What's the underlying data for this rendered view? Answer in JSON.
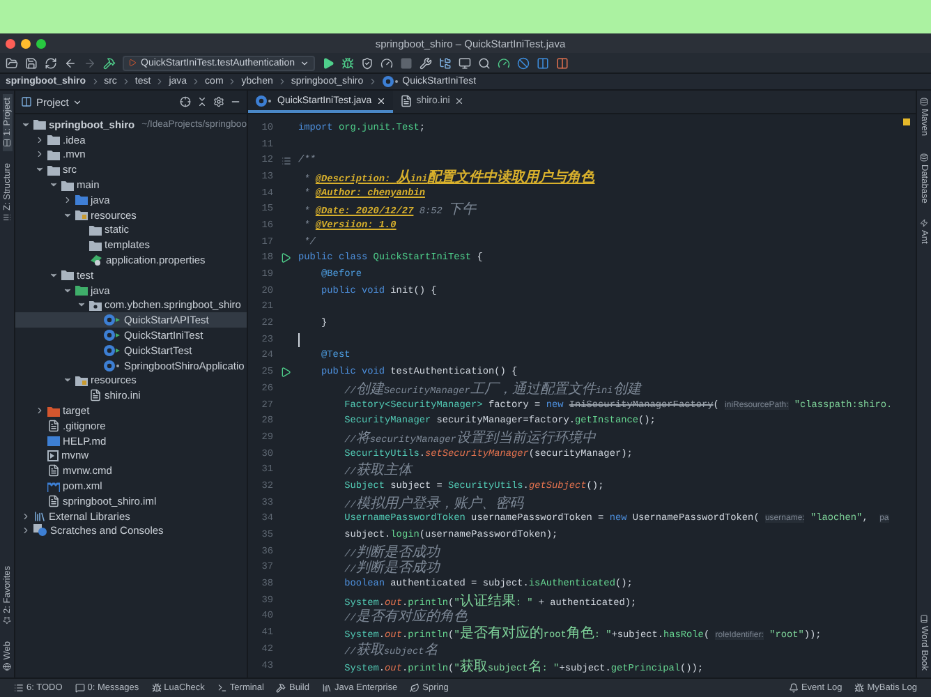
{
  "window": {
    "title": "springboot_shiro – QuickStartIniTest.java"
  },
  "toolbar": {
    "run_config": "QuickStartIniTest.testAuthentication"
  },
  "breadcrumb": [
    "springboot_shiro",
    "src",
    "test",
    "java",
    "com",
    "ybchen",
    "springboot_shiro",
    "QuickStartIniTest"
  ],
  "left_strip": [
    {
      "label": "1: Project",
      "selected": true,
      "kind": "project"
    },
    {
      "label": "Z: Structure",
      "selected": false,
      "kind": "structure"
    },
    {
      "label": "2: Favorites",
      "selected": false,
      "kind": "favorites"
    },
    {
      "label": "Web",
      "selected": false,
      "kind": "web"
    }
  ],
  "right_strip": [
    {
      "label": "Maven",
      "kind": "maven"
    },
    {
      "label": "Database",
      "kind": "database"
    },
    {
      "label": "Ant",
      "kind": "ant"
    },
    {
      "label": "Word Book",
      "kind": "book"
    }
  ],
  "project": {
    "title": "Project",
    "tree": [
      {
        "label": "springboot_shiro",
        "path": "~/IdeaProjects/springboo",
        "kind": "module",
        "expanded": true,
        "selected": false,
        "children": [
          {
            "label": ".idea",
            "kind": "folder",
            "expanded": false,
            "selected": false
          },
          {
            "label": ".mvn",
            "kind": "folder",
            "expanded": false,
            "selected": false
          },
          {
            "label": "src",
            "kind": "folder",
            "expanded": true,
            "selected": false,
            "children": [
              {
                "label": "main",
                "kind": "folder",
                "expanded": true,
                "selected": false,
                "children": [
                  {
                    "label": "java",
                    "kind": "source",
                    "expanded": false,
                    "selected": false
                  },
                  {
                    "label": "resources",
                    "kind": "resources",
                    "expanded": true,
                    "selected": false,
                    "children": [
                      {
                        "label": "static",
                        "kind": "folder",
                        "selected": false
                      },
                      {
                        "label": "templates",
                        "kind": "folder",
                        "selected": false
                      },
                      {
                        "label": "application.properties",
                        "kind": "properties",
                        "selected": false
                      }
                    ]
                  }
                ]
              },
              {
                "label": "test",
                "kind": "folder",
                "expanded": true,
                "selected": false,
                "children": [
                  {
                    "label": "java",
                    "kind": "tests",
                    "expanded": true,
                    "selected": false,
                    "children": [
                      {
                        "label": "com.ybchen.springboot_shiro",
                        "kind": "package",
                        "expanded": true,
                        "selected": false,
                        "children": [
                          {
                            "label": "QuickStartAPITest",
                            "kind": "testclass",
                            "selected": true
                          },
                          {
                            "label": "QuickStartIniTest",
                            "kind": "testclass",
                            "selected": false
                          },
                          {
                            "label": "QuickStartTest",
                            "kind": "testclass",
                            "selected": false
                          },
                          {
                            "label": "SpringbootShiroApplicatio",
                            "kind": "class",
                            "selected": false
                          }
                        ]
                      }
                    ]
                  },
                  {
                    "label": "resources",
                    "kind": "resources",
                    "expanded": true,
                    "selected": false,
                    "children": [
                      {
                        "label": "shiro.ini",
                        "kind": "file",
                        "selected": false
                      }
                    ]
                  }
                ]
              }
            ]
          },
          {
            "label": "target",
            "kind": "excluded",
            "expanded": false,
            "selected": false
          },
          {
            "label": ".gitignore",
            "kind": "file",
            "selected": false
          },
          {
            "label": "HELP.md",
            "kind": "markdown",
            "selected": false
          },
          {
            "label": "mvnw",
            "kind": "script",
            "selected": false
          },
          {
            "label": "mvnw.cmd",
            "kind": "file",
            "selected": false
          },
          {
            "label": "pom.xml",
            "kind": "maven",
            "selected": false
          },
          {
            "label": "springboot_shiro.iml",
            "kind": "file",
            "selected": false
          }
        ]
      },
      {
        "label": "External Libraries",
        "kind": "libraries",
        "expanded": false,
        "selected": false
      },
      {
        "label": "Scratches and Consoles",
        "kind": "scratches",
        "expanded": false,
        "selected": false
      }
    ]
  },
  "tabs": [
    {
      "label": "QuickStartIniTest.java",
      "kind": "class",
      "selected": true
    },
    {
      "label": "shiro.ini",
      "kind": "file",
      "selected": false
    }
  ],
  "code": [
    {
      "number": "10",
      "kind": "plain",
      "tokens": [
        {
          "kind": "kw",
          "s": "import "
        },
        {
          "kind": "cls",
          "s": "org.junit.Test"
        },
        {
          "kind": "p",
          "s": ";"
        }
      ]
    },
    {
      "number": "11",
      "kind": "plain"
    },
    {
      "number": "12",
      "kind": "doc",
      "tokens": [
        {
          "kind": "cmt",
          "s": "/**"
        }
      ]
    },
    {
      "number": "13",
      "kind": "plain",
      "tokens": [
        {
          "kind": "cmt",
          "s": " * "
        },
        {
          "kind": "doc",
          "s": "@Description: 从ini配置文件中读取用户与角色"
        }
      ]
    },
    {
      "number": "14",
      "kind": "plain",
      "tokens": [
        {
          "kind": "cmt",
          "s": " * "
        },
        {
          "kind": "doc",
          "s": "@Author: chenyanbin"
        }
      ]
    },
    {
      "number": "15",
      "kind": "plain",
      "tokens": [
        {
          "kind": "cmt",
          "s": " * "
        },
        {
          "kind": "doc",
          "s": "@Date: 2020/12/27"
        },
        {
          "kind": "cmt",
          "s": " 8:52 下午"
        }
      ]
    },
    {
      "number": "16",
      "kind": "plain",
      "tokens": [
        {
          "kind": "cmt",
          "s": " * "
        },
        {
          "kind": "doc",
          "s": "@Versiion: 1.0"
        }
      ]
    },
    {
      "number": "17",
      "kind": "plain",
      "tokens": [
        {
          "kind": "cmt",
          "s": " */"
        }
      ]
    },
    {
      "number": "18",
      "kind": "run",
      "tokens": [
        {
          "kind": "kw",
          "s": "public class "
        },
        {
          "kind": "cls",
          "s": "QuickStartIniTest"
        },
        {
          "kind": "p",
          "s": " {"
        }
      ]
    },
    {
      "number": "19",
      "kind": "plain",
      "tokens": [
        {
          "kind": "ann",
          "s": "    @Before"
        }
      ]
    },
    {
      "number": "20",
      "kind": "plain",
      "tokens": [
        {
          "kind": "kw",
          "s": "    public void "
        },
        {
          "kind": "p",
          "s": "init() {"
        }
      ]
    },
    {
      "number": "21",
      "kind": "plain"
    },
    {
      "number": "22",
      "kind": "plain",
      "tokens": [
        {
          "kind": "p",
          "s": "    }"
        }
      ]
    },
    {
      "number": "23",
      "kind": "caret"
    },
    {
      "number": "24",
      "kind": "plain",
      "tokens": [
        {
          "kind": "ann",
          "s": "    @Test"
        }
      ]
    },
    {
      "number": "25",
      "kind": "run",
      "tokens": [
        {
          "kind": "kw",
          "s": "    public void "
        },
        {
          "kind": "p",
          "s": "testAuthentication() {"
        }
      ]
    },
    {
      "number": "26",
      "kind": "plain",
      "tokens": [
        {
          "kind": "cmt",
          "s": "        //创建SecurityManager工厂，通过配置文件ini创建"
        }
      ]
    },
    {
      "number": "27",
      "kind": "plain",
      "tokens": [
        {
          "kind": "type",
          "s": "        Factory<SecurityManager>"
        },
        {
          "kind": "p",
          "s": " factory = "
        },
        {
          "kind": "kw",
          "s": "new "
        },
        {
          "kind": "dep",
          "s": "IniSecurityManagerFactory"
        },
        {
          "kind": "p",
          "s": "( "
        },
        {
          "kind": "hint",
          "s": "iniResourcePath:"
        },
        {
          "kind": "str",
          "s": " \"classpath:shiro."
        }
      ]
    },
    {
      "number": "28",
      "kind": "plain",
      "tokens": [
        {
          "kind": "type",
          "s": "        SecurityManager"
        },
        {
          "kind": "p",
          "s": " securityManager=factory."
        },
        {
          "kind": "fn",
          "s": "getInstance"
        },
        {
          "kind": "p",
          "s": "();"
        }
      ]
    },
    {
      "number": "29",
      "kind": "plain",
      "tokens": [
        {
          "kind": "cmt",
          "s": "        //将securityManager设置到当前运行环境中"
        }
      ]
    },
    {
      "number": "30",
      "kind": "plain",
      "tokens": [
        {
          "kind": "type",
          "s": "        SecurityUtils"
        },
        {
          "kind": "p",
          "s": "."
        },
        {
          "kind": "static",
          "s": "setSecurityManager"
        },
        {
          "kind": "p",
          "s": "(securityManager);"
        }
      ]
    },
    {
      "number": "31",
      "kind": "plain",
      "tokens": [
        {
          "kind": "cmt",
          "s": "        //获取主体"
        }
      ]
    },
    {
      "number": "32",
      "kind": "plain",
      "tokens": [
        {
          "kind": "type",
          "s": "        Subject"
        },
        {
          "kind": "p",
          "s": " subject = "
        },
        {
          "kind": "type",
          "s": "SecurityUtils"
        },
        {
          "kind": "p",
          "s": "."
        },
        {
          "kind": "static",
          "s": "getSubject"
        },
        {
          "kind": "p",
          "s": "();"
        }
      ]
    },
    {
      "number": "33",
      "kind": "plain",
      "tokens": [
        {
          "kind": "cmt",
          "s": "        //模拟用户登录，账户、密码"
        }
      ]
    },
    {
      "number": "34",
      "kind": "plain",
      "tokens": [
        {
          "kind": "type",
          "s": "        UsernamePasswordToken"
        },
        {
          "kind": "p",
          "s": " usernamePasswordToken = "
        },
        {
          "kind": "kw",
          "s": "new "
        },
        {
          "kind": "p",
          "s": "UsernamePasswordToken( "
        },
        {
          "kind": "hint",
          "s": "username:"
        },
        {
          "kind": "str",
          "s": " \"laochen\""
        },
        {
          "kind": "p",
          "s": ",  "
        },
        {
          "kind": "hint",
          "s": "pa"
        }
      ]
    },
    {
      "number": "35",
      "kind": "plain",
      "tokens": [
        {
          "kind": "p",
          "s": "        subject."
        },
        {
          "kind": "fn",
          "s": "login"
        },
        {
          "kind": "p",
          "s": "(usernamePasswordToken);"
        }
      ]
    },
    {
      "number": "36",
      "kind": "plain",
      "tokens": [
        {
          "kind": "cmt",
          "s": "        //判断是否成功"
        }
      ]
    },
    {
      "number": "37",
      "kind": "plain",
      "tokens": [
        {
          "kind": "cmt",
          "s": "        //判断是否成功"
        }
      ]
    },
    {
      "number": "38",
      "kind": "plain",
      "tokens": [
        {
          "kind": "kw",
          "s": "        boolean"
        },
        {
          "kind": "p",
          "s": " authenticated = subject."
        },
        {
          "kind": "fn",
          "s": "isAuthenticated"
        },
        {
          "kind": "p",
          "s": "();"
        }
      ]
    },
    {
      "number": "39",
      "kind": "plain",
      "tokens": [
        {
          "kind": "type",
          "s": "        System"
        },
        {
          "kind": "p",
          "s": "."
        },
        {
          "kind": "static",
          "s": "out"
        },
        {
          "kind": "p",
          "s": "."
        },
        {
          "kind": "fn",
          "s": "println"
        },
        {
          "kind": "p",
          "s": "("
        },
        {
          "kind": "str",
          "s": "\"认证结果: \""
        },
        {
          "kind": "p",
          "s": " + authenticated);"
        }
      ]
    },
    {
      "number": "40",
      "kind": "plain",
      "tokens": [
        {
          "kind": "cmt",
          "s": "        //是否有对应的角色"
        }
      ]
    },
    {
      "number": "41",
      "kind": "plain",
      "tokens": [
        {
          "kind": "type",
          "s": "        System"
        },
        {
          "kind": "p",
          "s": "."
        },
        {
          "kind": "static",
          "s": "out"
        },
        {
          "kind": "p",
          "s": "."
        },
        {
          "kind": "fn",
          "s": "println"
        },
        {
          "kind": "p",
          "s": "("
        },
        {
          "kind": "str",
          "s": "\"是否有对应的root角色: \""
        },
        {
          "kind": "p",
          "s": "+subject."
        },
        {
          "kind": "fn",
          "s": "hasRole"
        },
        {
          "kind": "p",
          "s": "( "
        },
        {
          "kind": "hint",
          "s": "roleIdentifier:"
        },
        {
          "kind": "str",
          "s": " \"root\""
        },
        {
          "kind": "p",
          "s": "));"
        }
      ]
    },
    {
      "number": "42",
      "kind": "plain",
      "tokens": [
        {
          "kind": "cmt",
          "s": "        //获取subject名"
        }
      ]
    },
    {
      "number": "43",
      "kind": "plain",
      "tokens": [
        {
          "kind": "type",
          "s": "        System"
        },
        {
          "kind": "p",
          "s": "."
        },
        {
          "kind": "static",
          "s": "out"
        },
        {
          "kind": "p",
          "s": "."
        },
        {
          "kind": "fn",
          "s": "println"
        },
        {
          "kind": "p",
          "s": "("
        },
        {
          "kind": "str",
          "s": "\"获取subject名: \""
        },
        {
          "kind": "p",
          "s": "+subject."
        },
        {
          "kind": "fn",
          "s": "getPrincipal"
        },
        {
          "kind": "p",
          "s": "());"
        }
      ]
    }
  ],
  "bottom_bar": {
    "left": [
      {
        "label": "6: TODO",
        "kind": "todo"
      },
      {
        "label": "0: Messages",
        "kind": "messages"
      },
      {
        "label": "LuaCheck",
        "kind": "lua"
      },
      {
        "label": "Terminal",
        "kind": "terminal"
      },
      {
        "label": "Build",
        "kind": "build"
      },
      {
        "label": "Java Enterprise",
        "kind": "enterprise"
      },
      {
        "label": "Spring",
        "kind": "spring"
      }
    ],
    "right": [
      {
        "label": "Event Log",
        "kind": "event"
      },
      {
        "label": "MyBatis Log",
        "kind": "mybatis"
      }
    ]
  }
}
